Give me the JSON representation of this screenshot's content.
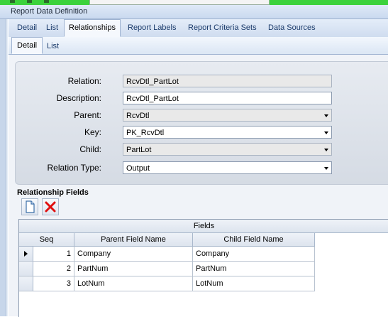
{
  "window": {
    "title": "Report Data Definition"
  },
  "tabs_primary": [
    {
      "label": "Detail",
      "active": false
    },
    {
      "label": "List",
      "active": false
    },
    {
      "label": "Relationships",
      "active": true
    },
    {
      "label": "Report Labels",
      "active": false
    },
    {
      "label": "Report Criteria Sets",
      "active": false
    },
    {
      "label": "Data Sources",
      "active": false
    }
  ],
  "tabs_secondary": [
    {
      "label": "Detail",
      "active": true
    },
    {
      "label": "List",
      "active": false
    }
  ],
  "form": {
    "relation": {
      "label": "Relation:",
      "value": "RcvDtl_PartLot"
    },
    "description": {
      "label": "Description:",
      "value": "RcvDtl_PartLot"
    },
    "parent": {
      "label": "Parent:",
      "value": "RcvDtl"
    },
    "key": {
      "label": "Key:",
      "value": "PK_RcvDtl"
    },
    "child": {
      "label": "Child:",
      "value": "PartLot"
    },
    "relation_type": {
      "label": "Relation Type:",
      "value": "Output"
    }
  },
  "relationship_fields": {
    "title": "Relationship Fields",
    "toolbar": {
      "new_icon": "new-document-icon",
      "delete_icon": "red-x-delete-icon"
    },
    "grid": {
      "group_header": "Fields",
      "columns": [
        "Seq",
        "Parent Field Name",
        "Child Field Name"
      ],
      "rows": [
        {
          "seq": "1",
          "parent": "Company",
          "child": "Company"
        },
        {
          "seq": "2",
          "parent": "PartNum",
          "child": "PartNum"
        },
        {
          "seq": "3",
          "parent": "LotNum",
          "child": "LotNum"
        }
      ]
    }
  },
  "colors": {
    "accent_green": "#3cd23c",
    "tab_bg": "#cfdcef",
    "delete_red": "#e01010"
  }
}
